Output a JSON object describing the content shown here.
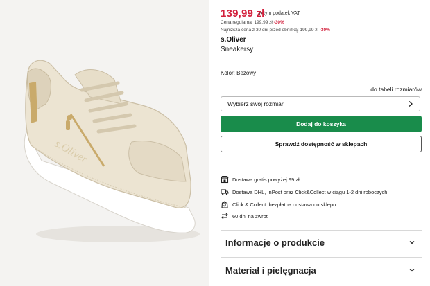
{
  "product": {
    "price": "139,99 zł",
    "vat_note": "w tym podatek VAT",
    "regular_price_label": "Cena regularna:",
    "regular_price_value": "199,99 zł",
    "regular_discount": "-30%",
    "lowest_price_label": "Najniższa cena z 30 dni przed obniżką:",
    "lowest_price_value": "199,99 zł",
    "lowest_discount": "-30%",
    "brand": "s.Oliver",
    "type": "Sneakersy",
    "color_label": "Kolor:",
    "color_value": "Beżowy",
    "image_text": "s.Oliver"
  },
  "sizing": {
    "size_table_link": "do tabeli rozmiarów",
    "size_select_placeholder": "Wybierz swój rozmiar"
  },
  "actions": {
    "add_to_cart": "Dodaj do koszyka",
    "check_availability": "Sprawdź dostępność w sklepach"
  },
  "benefits": [
    {
      "icon": "store-icon",
      "text": "Dostawa gratis powyżej 99 zł"
    },
    {
      "icon": "truck-icon",
      "text": "Dostawa DHL, InPost oraz Click&Collect w ciągu 1-2 dni roboczych"
    },
    {
      "icon": "bag-click-collect-icon",
      "text": "Click & Collect: bezpłatna dostawa do sklepu"
    },
    {
      "icon": "return-arrows-icon",
      "text": "60 dni na zwrot"
    }
  ],
  "accordion": [
    {
      "label": "Informacje o produkcie"
    },
    {
      "label": "Materiał i pielęgnacja"
    }
  ],
  "colors": {
    "price": "#d3203c",
    "cart_button": "#198c4b",
    "image_background": "#f4f3f1",
    "shoe": "#ece4d2"
  }
}
